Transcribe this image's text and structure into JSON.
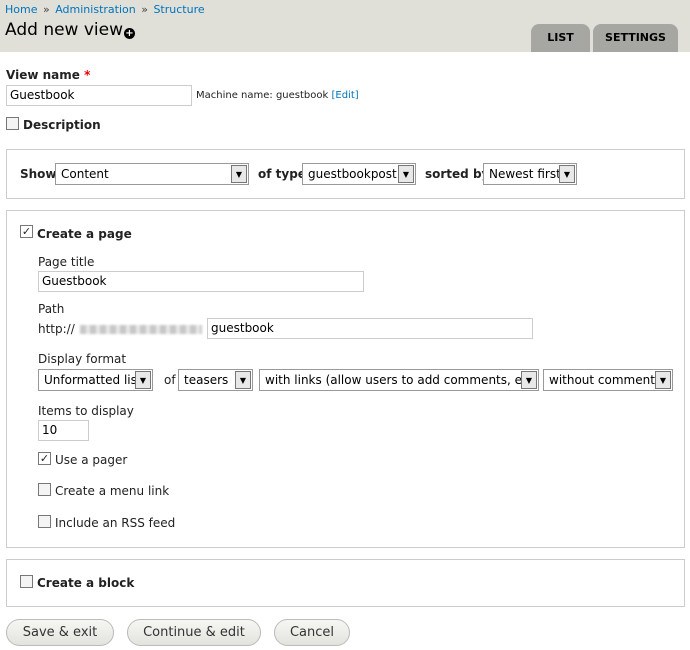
{
  "breadcrumb": [
    "Home",
    "Administration",
    "Structure"
  ],
  "breadcrumb_sep": "»",
  "page_title": "Add new view",
  "tabs": [
    "LIST",
    "SETTINGS"
  ],
  "view_name": {
    "label": "View name",
    "required_mark": "*",
    "value": "Guestbook",
    "machine_name_label": "Machine name: guestbook",
    "edit_link": "[Edit]"
  },
  "description_label": "Description",
  "show_row": {
    "show_label": "Show",
    "show_value": "Content",
    "of_type_label": "of type",
    "of_type_value": "guestbookpost",
    "sorted_by_label": "sorted by",
    "sorted_by_value": "Newest first"
  },
  "page_section": {
    "checkbox_label": "Create a page",
    "checked": true,
    "page_title_label": "Page title",
    "page_title_value": "Guestbook",
    "path_label": "Path",
    "path_prefix": "http://",
    "path_value": "guestbook",
    "display_format_label": "Display format",
    "format_value": "Unformatted list",
    "of_label": "of",
    "teasers_value": "teasers",
    "links_value": "with links (allow users to add comments, etc.)",
    "comments_value": "without comments",
    "items_label": "Items to display",
    "items_value": "10",
    "use_pager_label": "Use a pager",
    "use_pager_checked": true,
    "menu_link_label": "Create a menu link",
    "rss_label": "Include an RSS feed"
  },
  "block_section": {
    "checkbox_label": "Create a block"
  },
  "buttons": {
    "save_exit": "Save & exit",
    "continue_edit": "Continue & edit",
    "cancel": "Cancel"
  }
}
